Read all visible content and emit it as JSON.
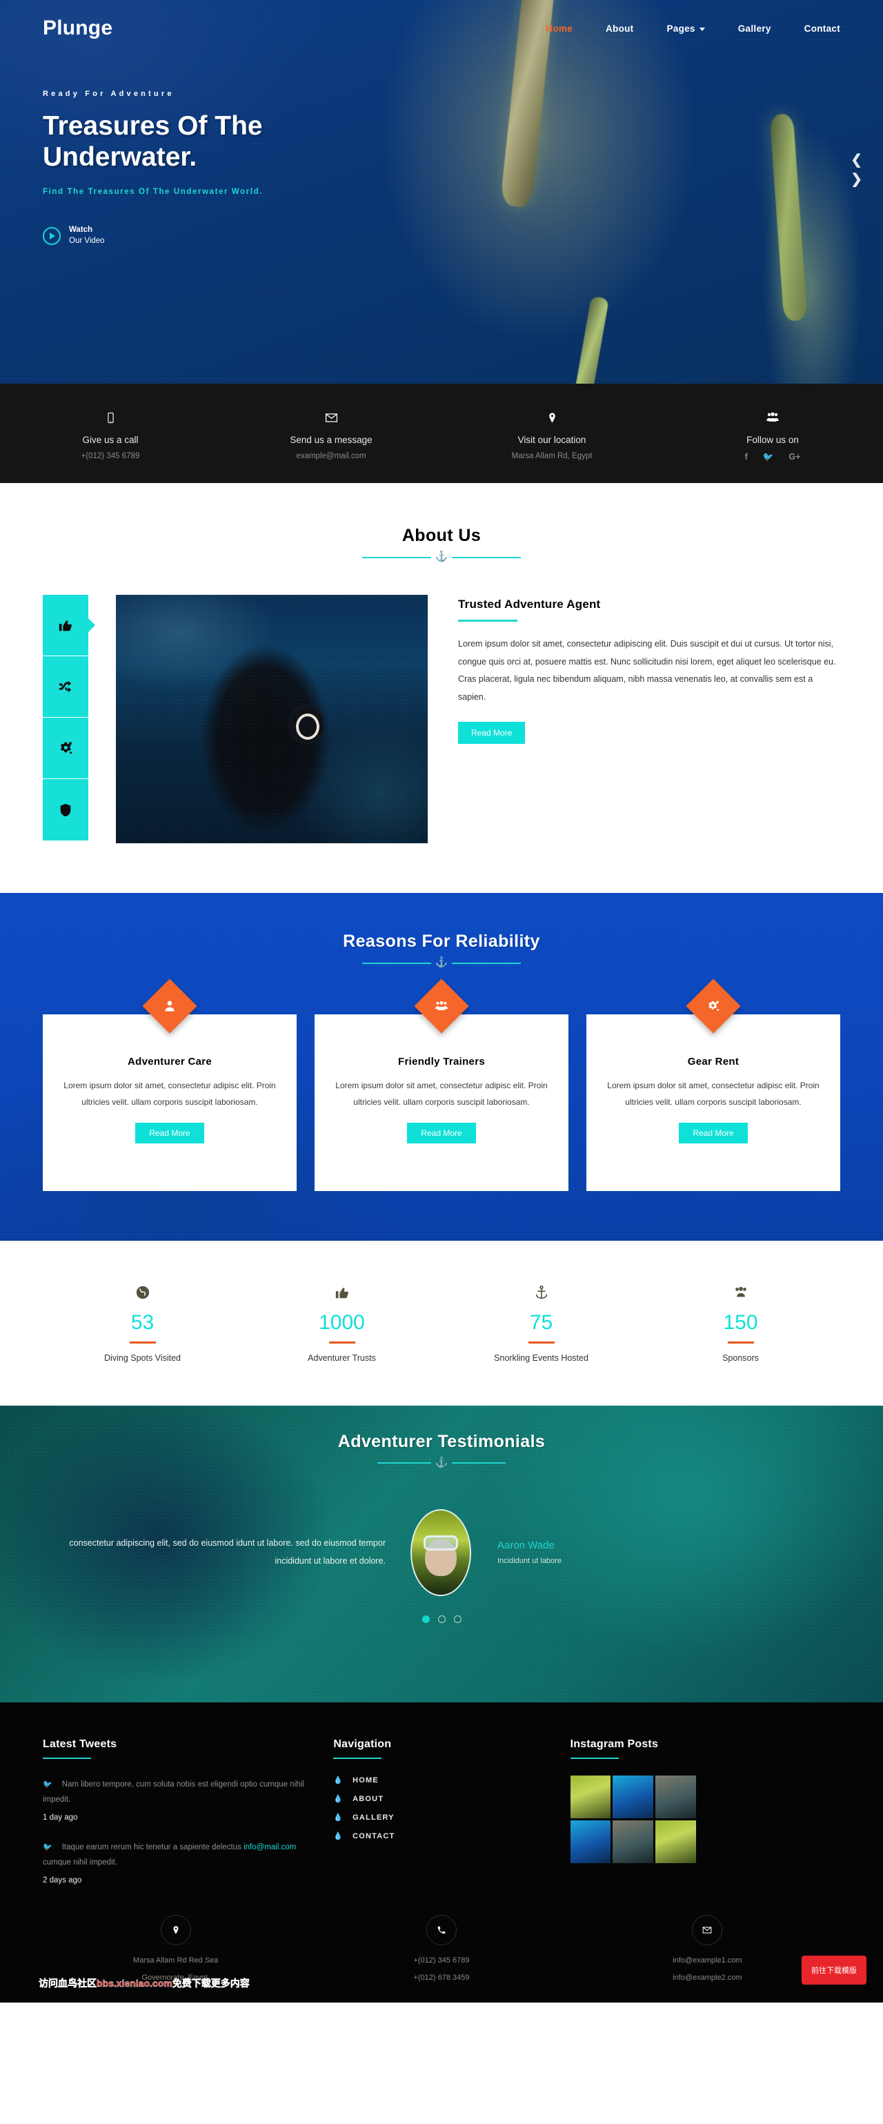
{
  "site": {
    "logo": "Plunge"
  },
  "nav": [
    {
      "label": "Home",
      "active": true
    },
    {
      "label": "About",
      "active": false
    },
    {
      "label": "Pages",
      "active": false,
      "has_dropdown": true
    },
    {
      "label": "Gallery",
      "active": false
    },
    {
      "label": "Contact",
      "active": false
    }
  ],
  "hero": {
    "eyebrow": "Ready For Adventure",
    "title_line1": "Treasures Of The",
    "title_line2": "Underwater.",
    "subtitle": "Find The Treasures Of The Underwater World.",
    "watch_top": "Watch",
    "watch_bottom": "Our Video",
    "prev_icon": "chevron-left-icon",
    "next_icon": "chevron-right-icon",
    "accent_color": "#17d8cf",
    "bg_color": "#0a3573"
  },
  "contact_strip": [
    {
      "icon": "mobile-phone-icon",
      "title": "Give us a call",
      "value": "+(012) 345 6789"
    },
    {
      "icon": "envelope-icon",
      "title": "Send us a message",
      "value": "example@mail.com"
    },
    {
      "icon": "map-pin-icon",
      "title": "Visit our location",
      "value": "Marsa Allam Rd, Egypt"
    },
    {
      "icon": "users-icon",
      "title": "Follow us on",
      "value": ""
    }
  ],
  "social_links": [
    "f",
    "t",
    "G+"
  ],
  "about": {
    "section_title": "About Us",
    "tabs": [
      {
        "icon": "thumbs-up-icon",
        "active": true
      },
      {
        "icon": "shuffle-icon",
        "active": false
      },
      {
        "icon": "gears-icon",
        "active": false
      },
      {
        "icon": "shield-icon",
        "active": false
      }
    ],
    "image_alt": "scuba-diver-photo",
    "heading": "Trusted Adventure Agent",
    "paragraph": "Lorem ipsum dolor sit amet, consectetur adipiscing elit. Duis suscipit et dui ut cursus. Ut tortor nisi, congue quis orci at, posuere mattis est. Nunc sollicitudin nisi lorem, eget aliquet leo scelerisque eu. Cras placerat, ligula nec bibendum aliquam, nibh massa venenatis leo, at convallis sem est a sapien.",
    "button": "Read More"
  },
  "reasons": {
    "section_title": "Reasons For Reliability",
    "cards": [
      {
        "icon": "user-icon",
        "title": "Adventurer Care",
        "text": "Lorem ipsum dolor sit amet, consectetur adipisc elit. Proin ultricies velit. ullam corporis suscipit laboriosam.",
        "button": "Read More"
      },
      {
        "icon": "users-group-icon",
        "title": "Friendly Trainers",
        "text": "Lorem ipsum dolor sit amet, consectetur adipisc elit. Proin ultricies velit. ullam corporis suscipit laboriosam.",
        "button": "Read More"
      },
      {
        "icon": "gears-icon",
        "title": "Gear Rent",
        "text": "Lorem ipsum dolor sit amet, consectetur adipisc elit. Proin ultricies velit. ullam corporis suscipit laboriosam.",
        "button": "Read More"
      }
    ]
  },
  "counters": [
    {
      "icon": "globe-icon",
      "number": "53",
      "label": "Diving Spots Visited"
    },
    {
      "icon": "thumbs-up-icon",
      "number": "1000",
      "label": "Adventurer Trusts"
    },
    {
      "icon": "anchor-icon",
      "number": "75",
      "label": "Snorkling Events Hosted"
    },
    {
      "icon": "users-icon",
      "number": "150",
      "label": "Sponsors"
    }
  ],
  "testimonials": {
    "section_title": "Adventurer Testimonials",
    "quote": "consectetur adipiscing elit, sed do eiusmod idunt ut labore. sed do eiusmod tempor incididunt ut labore et dolore.",
    "author": "Aaron Wade",
    "role": "Incididunt ut labore",
    "avatar_alt": "snorkeler-portrait",
    "dots": [
      true,
      false,
      false
    ]
  },
  "footer": {
    "tweets": {
      "heading": "Latest Tweets",
      "items": [
        {
          "icon": "twitter-icon",
          "text": "Nam libero tempore, cum soluta nobis est eligendi optio cumque nihil impedit.",
          "link": "",
          "time": "1 day ago"
        },
        {
          "icon": "twitter-icon",
          "text_before": "Itaque earum rerum hic tenetur a sapiente delectus ",
          "link": "info@mail.com",
          "text_after": " cumque nihil impedit.",
          "time": "2 days ago"
        }
      ]
    },
    "navigation": {
      "heading": "Navigation",
      "items": [
        {
          "icon": "droplet-icon",
          "label": "HOME"
        },
        {
          "icon": "droplet-icon",
          "label": "ABOUT"
        },
        {
          "icon": "droplet-icon",
          "label": "GALLERY"
        },
        {
          "icon": "droplet-icon",
          "label": "CONTACT"
        }
      ]
    },
    "instagram": {
      "heading": "Instagram Posts",
      "thumbs": [
        "a",
        "b",
        "c",
        "b",
        "c",
        "a"
      ]
    },
    "bottom": [
      {
        "icon": "map-pin-icon",
        "line1": "Marsa Allam Rd Red Sea",
        "line2": "Governorate, Egypt."
      },
      {
        "icon": "phone-icon",
        "line1": "+(012) 345 6789",
        "line2": "+(012) 678 3459"
      },
      {
        "icon": "envelope-icon",
        "line1": "info@example1.com",
        "line2": "info@example2.com"
      }
    ],
    "watermark": "访问血鸟社区bbs.xienlao.com免费下载更多内容",
    "download_button": "前往下载模版"
  }
}
